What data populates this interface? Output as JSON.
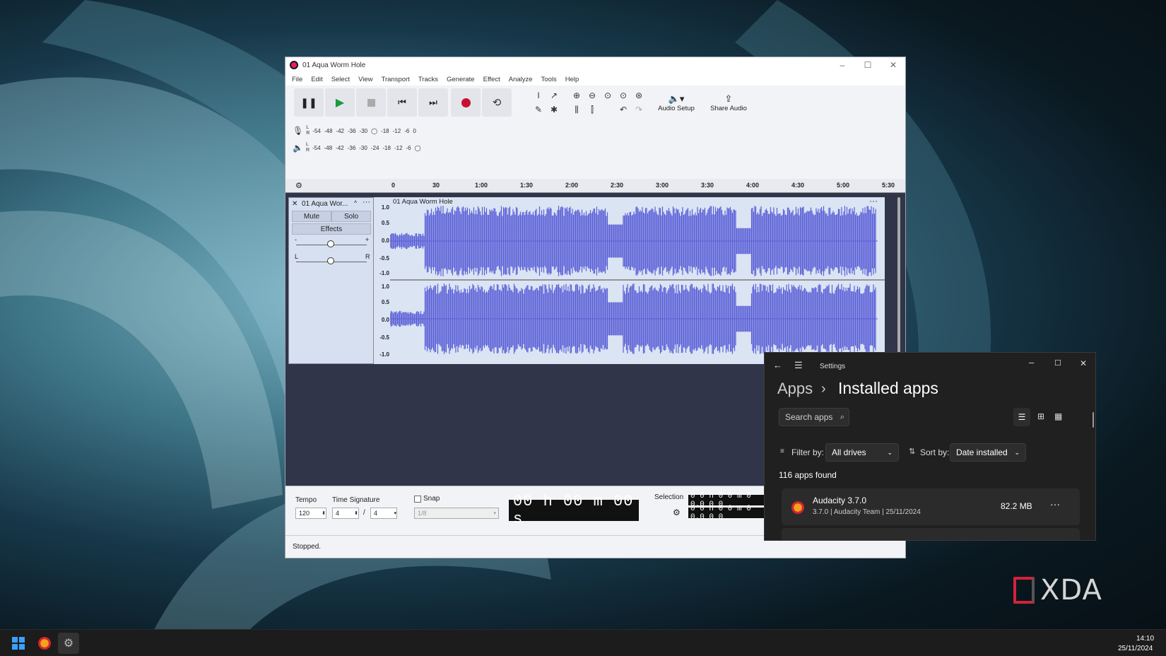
{
  "audacity": {
    "title": "01 Aqua Worm Hole",
    "menu": [
      "File",
      "Edit",
      "Select",
      "View",
      "Transport",
      "Tracks",
      "Generate",
      "Effect",
      "Analyze",
      "Tools",
      "Help"
    ],
    "audio_setup_label": "Audio Setup",
    "share_audio_label": "Share Audio",
    "rec_meter_ticks": [
      "-54",
      "-48",
      "-42",
      "-36",
      "-30",
      "-18",
      "-12",
      "-6",
      "0"
    ],
    "play_meter_ticks": [
      "-54",
      "-48",
      "-42",
      "-36",
      "-30",
      "-24",
      "-18",
      "-12",
      "-6"
    ],
    "meter_lr": [
      "L",
      "R"
    ],
    "ruler_labels": [
      "0",
      "30",
      "1:00",
      "1:30",
      "2:00",
      "2:30",
      "3:00",
      "3:30",
      "4:00",
      "4:30",
      "5:00",
      "5:30"
    ],
    "track": {
      "name": "01 Aqua Wor...",
      "clip_name": "01 Aqua Worm Hole",
      "mute": "Mute",
      "solo": "Solo",
      "effects": "Effects",
      "gain_minus": "-",
      "gain_plus": "+",
      "pan_left": "L",
      "pan_right": "R",
      "scale": [
        "1.0",
        "0.5",
        "0.0",
        "-0.5",
        "-1.0"
      ]
    },
    "tempo_label": "Tempo",
    "tempo_value": "120",
    "time_sig_label": "Time Signature",
    "time_sig_num": "4",
    "time_sig_sep": "/",
    "time_sig_den": "4",
    "snap_label": "Snap",
    "snap_value": "1/8",
    "time_display": "00 h 00 m 00 s",
    "selection_label": "Selection",
    "selection_start": "0 0 h 0 0 m 0 0.0 0 0",
    "selection_end": "0 0 h 0 0 m 0 0.0 0 0",
    "status": "Stopped.",
    "colors": {
      "waveform": "#5a5fd6",
      "track_bg": "#dbe4f3",
      "empty_area": "#30354a"
    }
  },
  "settings": {
    "title": "Settings",
    "breadcrumb_parent": "Apps",
    "breadcrumb_sep": "›",
    "breadcrumb_current": "Installed apps",
    "search_placeholder": "Search apps",
    "filter_label": "Filter by:",
    "filter_value": "All drives",
    "sort_label": "Sort by:",
    "sort_value": "Date installed",
    "apps_found": "116 apps found",
    "app": {
      "name": "Audacity 3.7.0",
      "version": "3.7.0",
      "sep": "|",
      "publisher": "Audacity Team",
      "date": "25/11/2024",
      "size": "82.2 MB"
    }
  },
  "taskbar": {
    "time": "14:10",
    "date": "25/11/2024"
  },
  "watermark": "XDA"
}
